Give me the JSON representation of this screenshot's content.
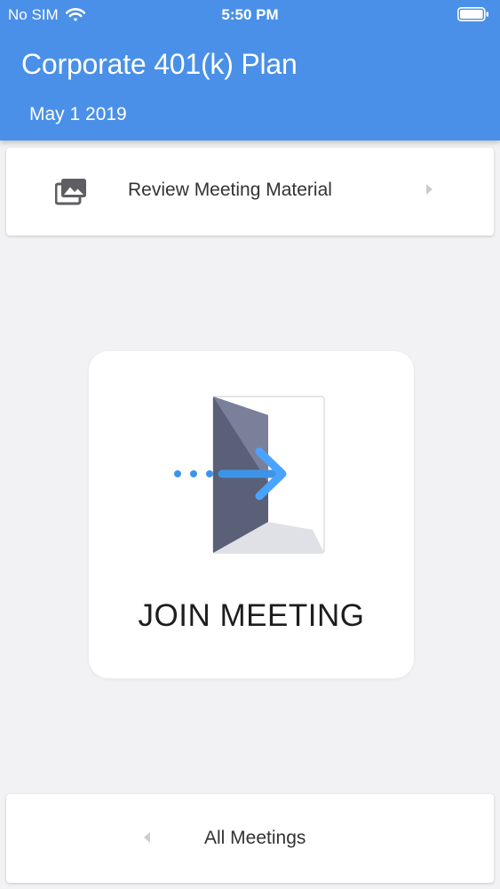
{
  "status_bar": {
    "carrier": "No SIM",
    "time": "5:50 PM",
    "wifi_icon": "wifi-icon",
    "battery_icon": "battery-full-icon"
  },
  "header": {
    "title": "Corporate 401(k) Plan",
    "date": "May 1 2019",
    "background_color": "#4a90e8"
  },
  "review_material": {
    "label": "Review Meeting Material",
    "icon": "photo-library-icon",
    "chevron": "chevron-right-icon"
  },
  "join_meeting": {
    "label": "JOIN MEETING",
    "illustration": "door-enter-illustration",
    "arrow_color": "#3d94e6"
  },
  "all_meetings": {
    "label": "All Meetings",
    "chevron": "chevron-left-icon"
  }
}
